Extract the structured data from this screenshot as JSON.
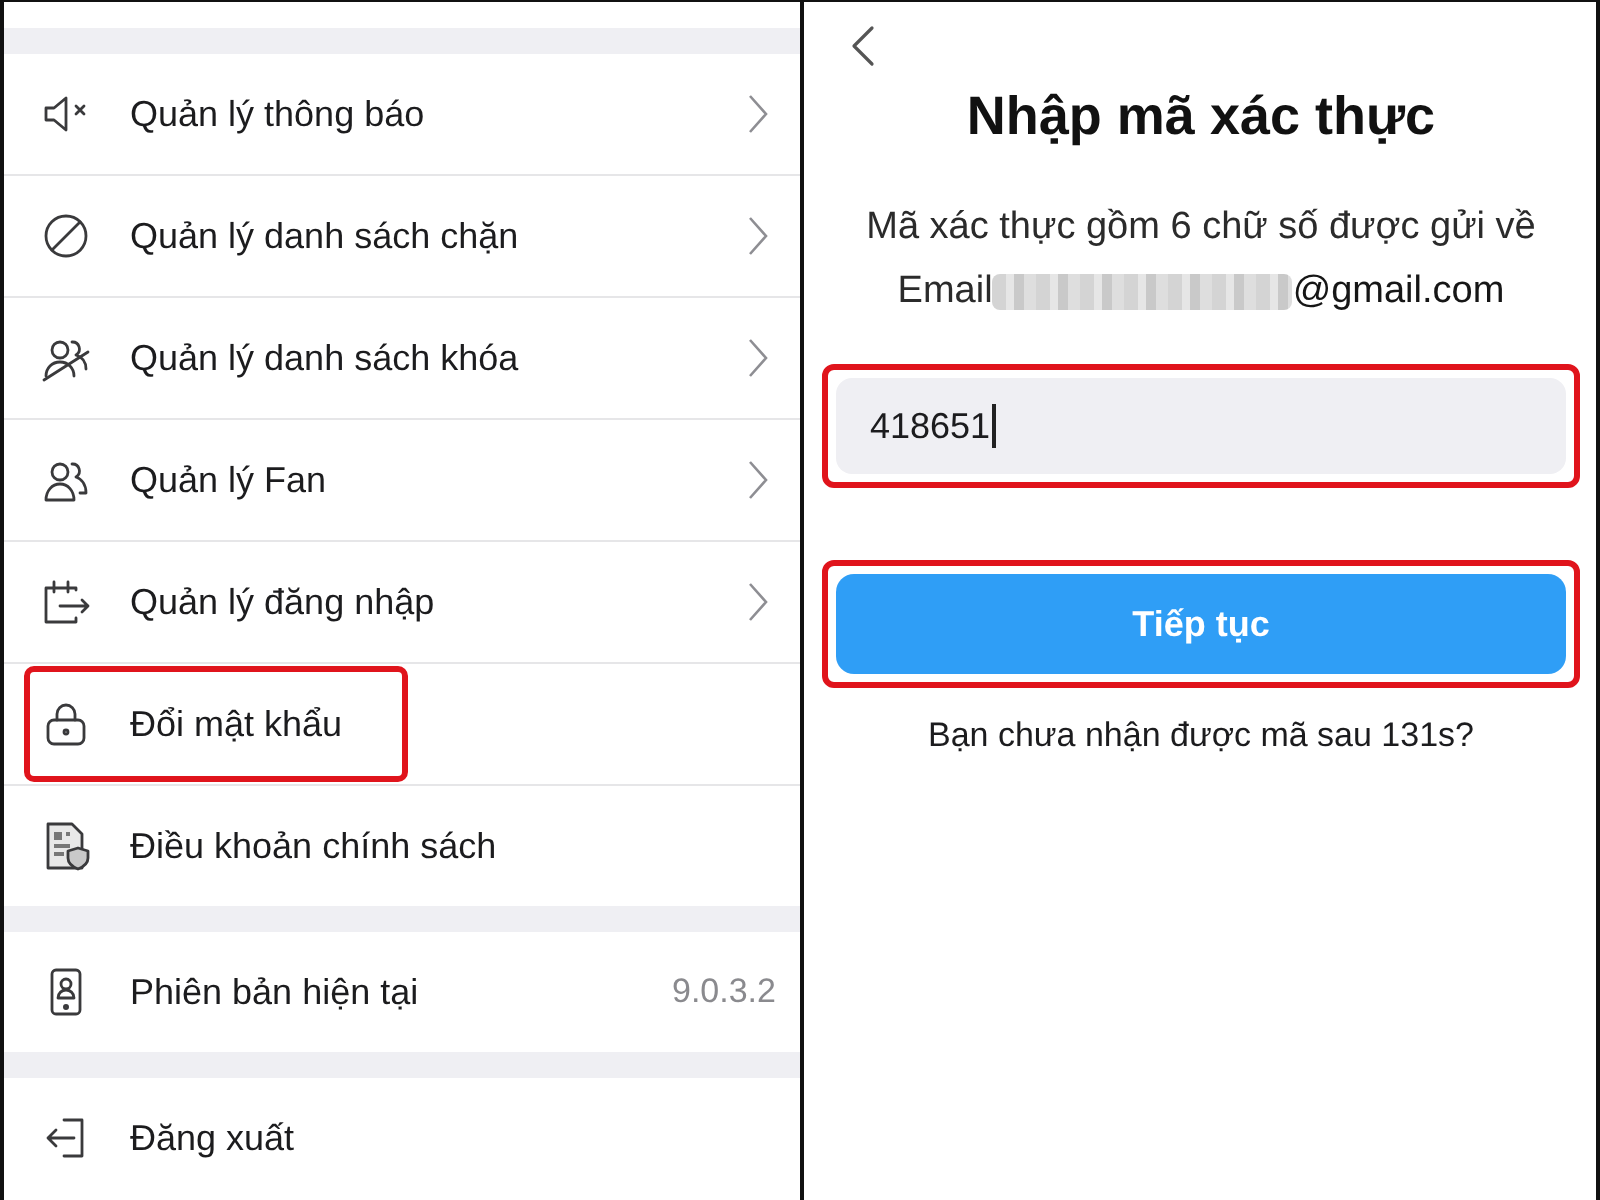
{
  "settings_menu": {
    "groups": [
      {
        "items": [
          {
            "label": "Quản lý thông báo",
            "chevron": true,
            "highlighted": false
          },
          {
            "label": "Quản lý danh sách chặn",
            "chevron": true,
            "highlighted": false
          },
          {
            "label": "Quản lý danh sách khóa",
            "chevron": true,
            "highlighted": false
          },
          {
            "label": "Quản lý Fan",
            "chevron": true,
            "highlighted": false
          },
          {
            "label": "Quản lý đăng nhập",
            "chevron": true,
            "highlighted": false
          },
          {
            "label": "Đổi mật khẩu",
            "chevron": false,
            "highlighted": true
          },
          {
            "label": "Điều khoản chính sách",
            "chevron": false,
            "highlighted": false
          }
        ]
      },
      {
        "items": [
          {
            "label": "Phiên bản hiện tại",
            "value": "9.0.3.2",
            "chevron": false,
            "highlighted": false
          }
        ]
      },
      {
        "items": [
          {
            "label": "Đăng xuất",
            "chevron": false,
            "highlighted": false
          }
        ]
      }
    ]
  },
  "verify_screen": {
    "title": "Nhập mã xác thực",
    "description": "Mã xác thực gồm 6 chữ số được gửi về",
    "email_label": "Email",
    "email_domain": "@gmail.com",
    "code_input": {
      "value": "418651",
      "focused": true,
      "highlighted": true
    },
    "continue_button": {
      "label": "Tiếp tục",
      "highlighted": true
    },
    "resend_note": "Bạn chưa nhận được mã sau 131s?"
  }
}
